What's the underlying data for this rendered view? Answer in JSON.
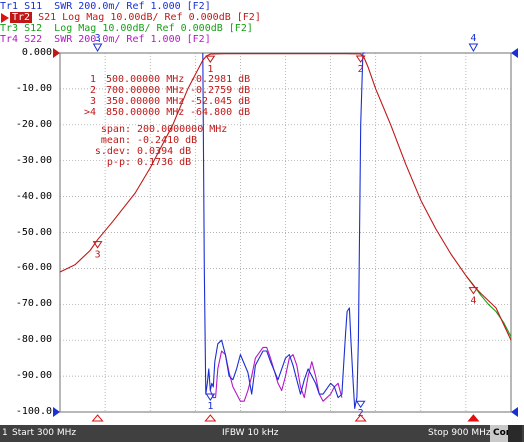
{
  "traces": [
    {
      "id": "Tr1",
      "param": "S11",
      "format": "SWR",
      "scale": "200.0m/",
      "ref": "Ref 1.000",
      "port": "[F2]",
      "color": "#1a2fd4"
    },
    {
      "id": "Tr2",
      "param": "S21",
      "format": "Log Mag",
      "scale": "10.00dB/",
      "ref": "Ref 0.000dB",
      "port": "[F2]",
      "color": "#c01818",
      "active": true
    },
    {
      "id": "Tr3",
      "param": "S12",
      "format": "Log Mag",
      "scale": "10.00dB/",
      "ref": "Ref 0.000dB",
      "port": "[F2]",
      "color": "#16a016"
    },
    {
      "id": "Tr4",
      "param": "S22",
      "format": "SWR",
      "scale": "200.0m/",
      "ref": "Ref 1.000",
      "port": "[F2]",
      "color": "#b418c8"
    }
  ],
  "y_axis": {
    "ticks": [
      "0.000",
      "-10.00",
      "-20.00",
      "-30.00",
      "-40.00",
      "-50.00",
      "-60.00",
      "-70.00",
      "-80.00",
      "-90.00",
      "-100.0"
    ]
  },
  "markers": [
    {
      "num": "1",
      "freq": "500.00000 MHz",
      "value": "-0.2981 dB",
      "active": false
    },
    {
      "num": "2",
      "freq": "700.00000 MHz",
      "value": "-0.2759 dB",
      "active": false
    },
    {
      "num": "3",
      "freq": "350.00000 MHz",
      "value": "-52.045 dB",
      "active": false
    },
    {
      "num": ">4",
      "freq": "850.00000 MHz",
      "value": "-64.800 dB",
      "active": true
    }
  ],
  "stats": [
    {
      "label": "span:",
      "value": "200.0000000 MHz"
    },
    {
      "label": "mean:",
      "value": "-0.2410 dB"
    },
    {
      "label": "s.dev:",
      "value": "0.0394 dB"
    },
    {
      "label": "p-p:",
      "value": "0.1736 dB"
    }
  ],
  "status": {
    "index": "1",
    "start": "Start 300 MHz",
    "ifbw": "IFBW 10 kHz",
    "stop": "Stop 900 MHz",
    "cor": "Cor"
  },
  "chart_data": {
    "type": "line",
    "xlim_mhz": [
      300,
      900
    ],
    "ylim_db": [
      -100,
      0
    ],
    "series": [
      {
        "name": "Tr2 S21",
        "color": "#c01818",
        "x": [
          300,
          320,
          340,
          350,
          370,
          400,
          420,
          450,
          470,
          490,
          495,
          500,
          520,
          560,
          600,
          640,
          680,
          700,
          705,
          710,
          720,
          740,
          760,
          780,
          800,
          820,
          840,
          850,
          860,
          880,
          900
        ],
        "y": [
          -61,
          -59,
          -55,
          -52,
          -47,
          -39,
          -32,
          -20,
          -10,
          -2,
          -0.8,
          -0.3,
          -0.2,
          -0.2,
          -0.2,
          -0.2,
          -0.2,
          -0.28,
          -1.5,
          -4,
          -10,
          -20,
          -31,
          -41,
          -49,
          -56,
          -62,
          -64.8,
          -67,
          -71,
          -80
        ]
      },
      {
        "name": "Tr3 S12",
        "color": "#16a016",
        "x": [
          840,
          850,
          860,
          870,
          880,
          890,
          900
        ],
        "y": [
          -62,
          -64.6,
          -67.5,
          -70,
          -72,
          -75,
          -79
        ]
      },
      {
        "name": "Tr1 S11",
        "color": "#1a2fd4",
        "x": [
          490,
          492,
          494,
          496,
          498,
          500,
          502,
          504,
          506,
          510,
          515,
          520,
          525,
          530,
          535,
          540,
          550,
          555,
          560,
          570,
          575,
          580,
          590,
          600,
          605,
          610,
          620,
          625,
          630,
          640,
          645,
          650,
          660,
          665,
          670,
          675,
          677,
          680,
          682,
          685,
          687,
          690,
          692,
          695,
          697,
          700,
          703,
          706
        ],
        "y": [
          0,
          -60,
          -95,
          -92,
          -88,
          -94,
          -92,
          -93,
          -86,
          -81,
          -80,
          -84,
          -90,
          -91,
          -88,
          -84,
          -89,
          -95,
          -87,
          -83,
          -83,
          -86,
          -91,
          -85,
          -84,
          -87,
          -95,
          -91,
          -88,
          -92,
          -95,
          -95,
          -92,
          -93,
          -96,
          -95,
          -88,
          -78,
          -72,
          -71,
          -80,
          -92,
          -99,
          -96,
          -80,
          -20,
          0,
          0
        ]
      },
      {
        "name": "Tr4 S22",
        "color": "#b418c8",
        "x": [
          500,
          504,
          507,
          510,
          515,
          520,
          525,
          530,
          540,
          545,
          550,
          555,
          560,
          570,
          575,
          580,
          590,
          595,
          600,
          605,
          610,
          615,
          620,
          625,
          630,
          635,
          640,
          645,
          650,
          660,
          665,
          670,
          675
        ],
        "y": [
          -94,
          -96,
          -96,
          -88,
          -83,
          -84,
          -89,
          -93,
          -97,
          -97,
          -94,
          -90,
          -85,
          -82,
          -82,
          -85,
          -92,
          -94,
          -90,
          -85,
          -84,
          -87,
          -93,
          -96,
          -90,
          -86,
          -90,
          -95,
          -97,
          -95,
          -93,
          -92,
          -96
        ]
      }
    ],
    "marker_points": [
      {
        "label": "1",
        "x": 500,
        "y": -0.3
      },
      {
        "label": "2",
        "x": 700,
        "y": -0.28
      },
      {
        "label": "3",
        "x": 350,
        "y": -52
      },
      {
        "label": "4",
        "x": 850,
        "y": -64.8
      }
    ]
  }
}
